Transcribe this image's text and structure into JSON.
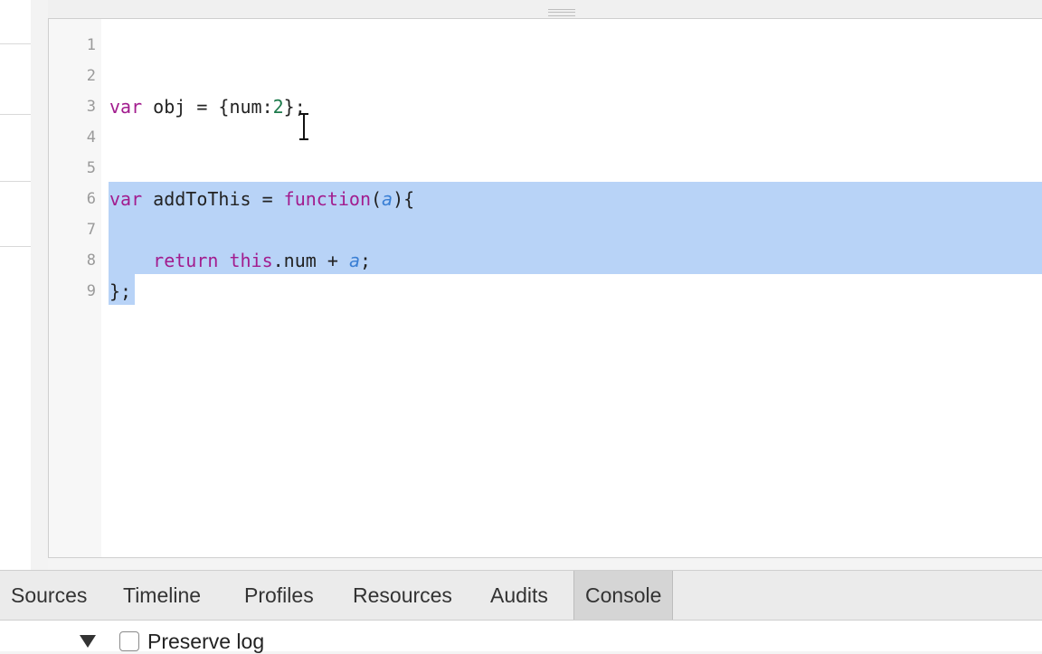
{
  "editor": {
    "lines": [
      {
        "num": "1",
        "tokens": []
      },
      {
        "num": "2",
        "tokens": []
      },
      {
        "num": "3",
        "tokens": [
          {
            "t": "var",
            "c": "kw"
          },
          {
            "t": " obj = {num:",
            "c": ""
          },
          {
            "t": "2",
            "c": "num-lit"
          },
          {
            "t": "};",
            "c": ""
          }
        ]
      },
      {
        "num": "4",
        "tokens": []
      },
      {
        "num": "5",
        "tokens": []
      },
      {
        "num": "6",
        "tokens": [
          {
            "t": "var",
            "c": "kw"
          },
          {
            "t": " addToThis = ",
            "c": ""
          },
          {
            "t": "function",
            "c": "kw"
          },
          {
            "t": "(",
            "c": ""
          },
          {
            "t": "a",
            "c": "param"
          },
          {
            "t": "){",
            "c": ""
          }
        ]
      },
      {
        "num": "7",
        "tokens": []
      },
      {
        "num": "8",
        "tokens": [
          {
            "t": "    ",
            "c": ""
          },
          {
            "t": "return",
            "c": "kw"
          },
          {
            "t": " ",
            "c": ""
          },
          {
            "t": "this",
            "c": "kw"
          },
          {
            "t": ".num + ",
            "c": ""
          },
          {
            "t": "a",
            "c": "param"
          },
          {
            "t": ";",
            "c": ""
          }
        ]
      },
      {
        "num": "9",
        "tokens": [
          {
            "t": "};",
            "c": ""
          }
        ]
      }
    ]
  },
  "tabs": [
    {
      "label": "Sources",
      "active": false
    },
    {
      "label": "Timeline",
      "active": false
    },
    {
      "label": "Profiles",
      "active": false
    },
    {
      "label": "Resources",
      "active": false
    },
    {
      "label": "Audits",
      "active": false
    },
    {
      "label": "Console",
      "active": true
    }
  ],
  "console": {
    "preserve_log_label": "Preserve log",
    "preserve_log_checked": false
  },
  "colors": {
    "keyword": "#a21c8e",
    "number": "#1c7a4b",
    "param": "#3a7fd4",
    "selection": "#b8d3f7"
  },
  "icons": {
    "cursor": "text-cursor-icon",
    "expand": "triangle-down-icon"
  }
}
